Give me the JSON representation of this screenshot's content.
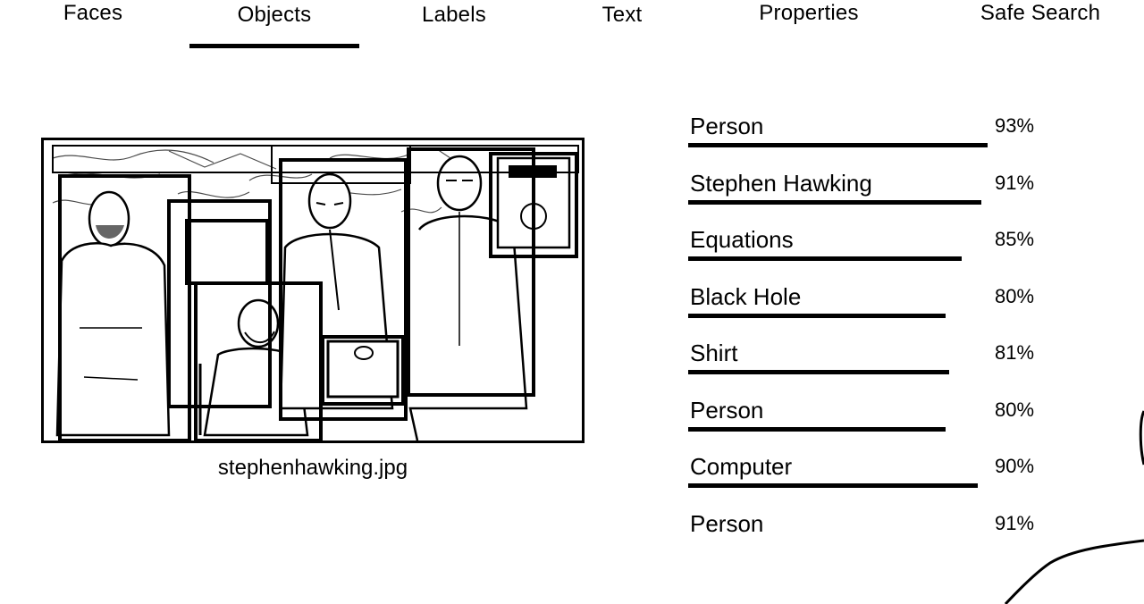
{
  "tabs": [
    {
      "label": "Faces",
      "active": false
    },
    {
      "label": "Objects",
      "active": true
    },
    {
      "label": "Labels",
      "active": false
    },
    {
      "label": "Text",
      "active": false
    },
    {
      "label": "Properties",
      "active": false
    },
    {
      "label": "Safe Search",
      "active": false
    }
  ],
  "image": {
    "filename": "stephenhawking.jpg"
  },
  "results": [
    {
      "label": "Person",
      "score": "93%",
      "fraction": 0.93
    },
    {
      "label": "Stephen Hawking",
      "score": "91%",
      "fraction": 0.91
    },
    {
      "label": "Equations",
      "score": "85%",
      "fraction": 0.85
    },
    {
      "label": "Black Hole",
      "score": "80%",
      "fraction": 0.8
    },
    {
      "label": "Shirt",
      "score": "81%",
      "fraction": 0.81
    },
    {
      "label": "Person",
      "score": "80%",
      "fraction": 0.8
    },
    {
      "label": "Computer",
      "score": "90%",
      "fraction": 0.9
    },
    {
      "label": "Person",
      "score": "91%",
      "fraction": null
    }
  ],
  "colors": {
    "ink": "#000000",
    "background": "#ffffff"
  }
}
